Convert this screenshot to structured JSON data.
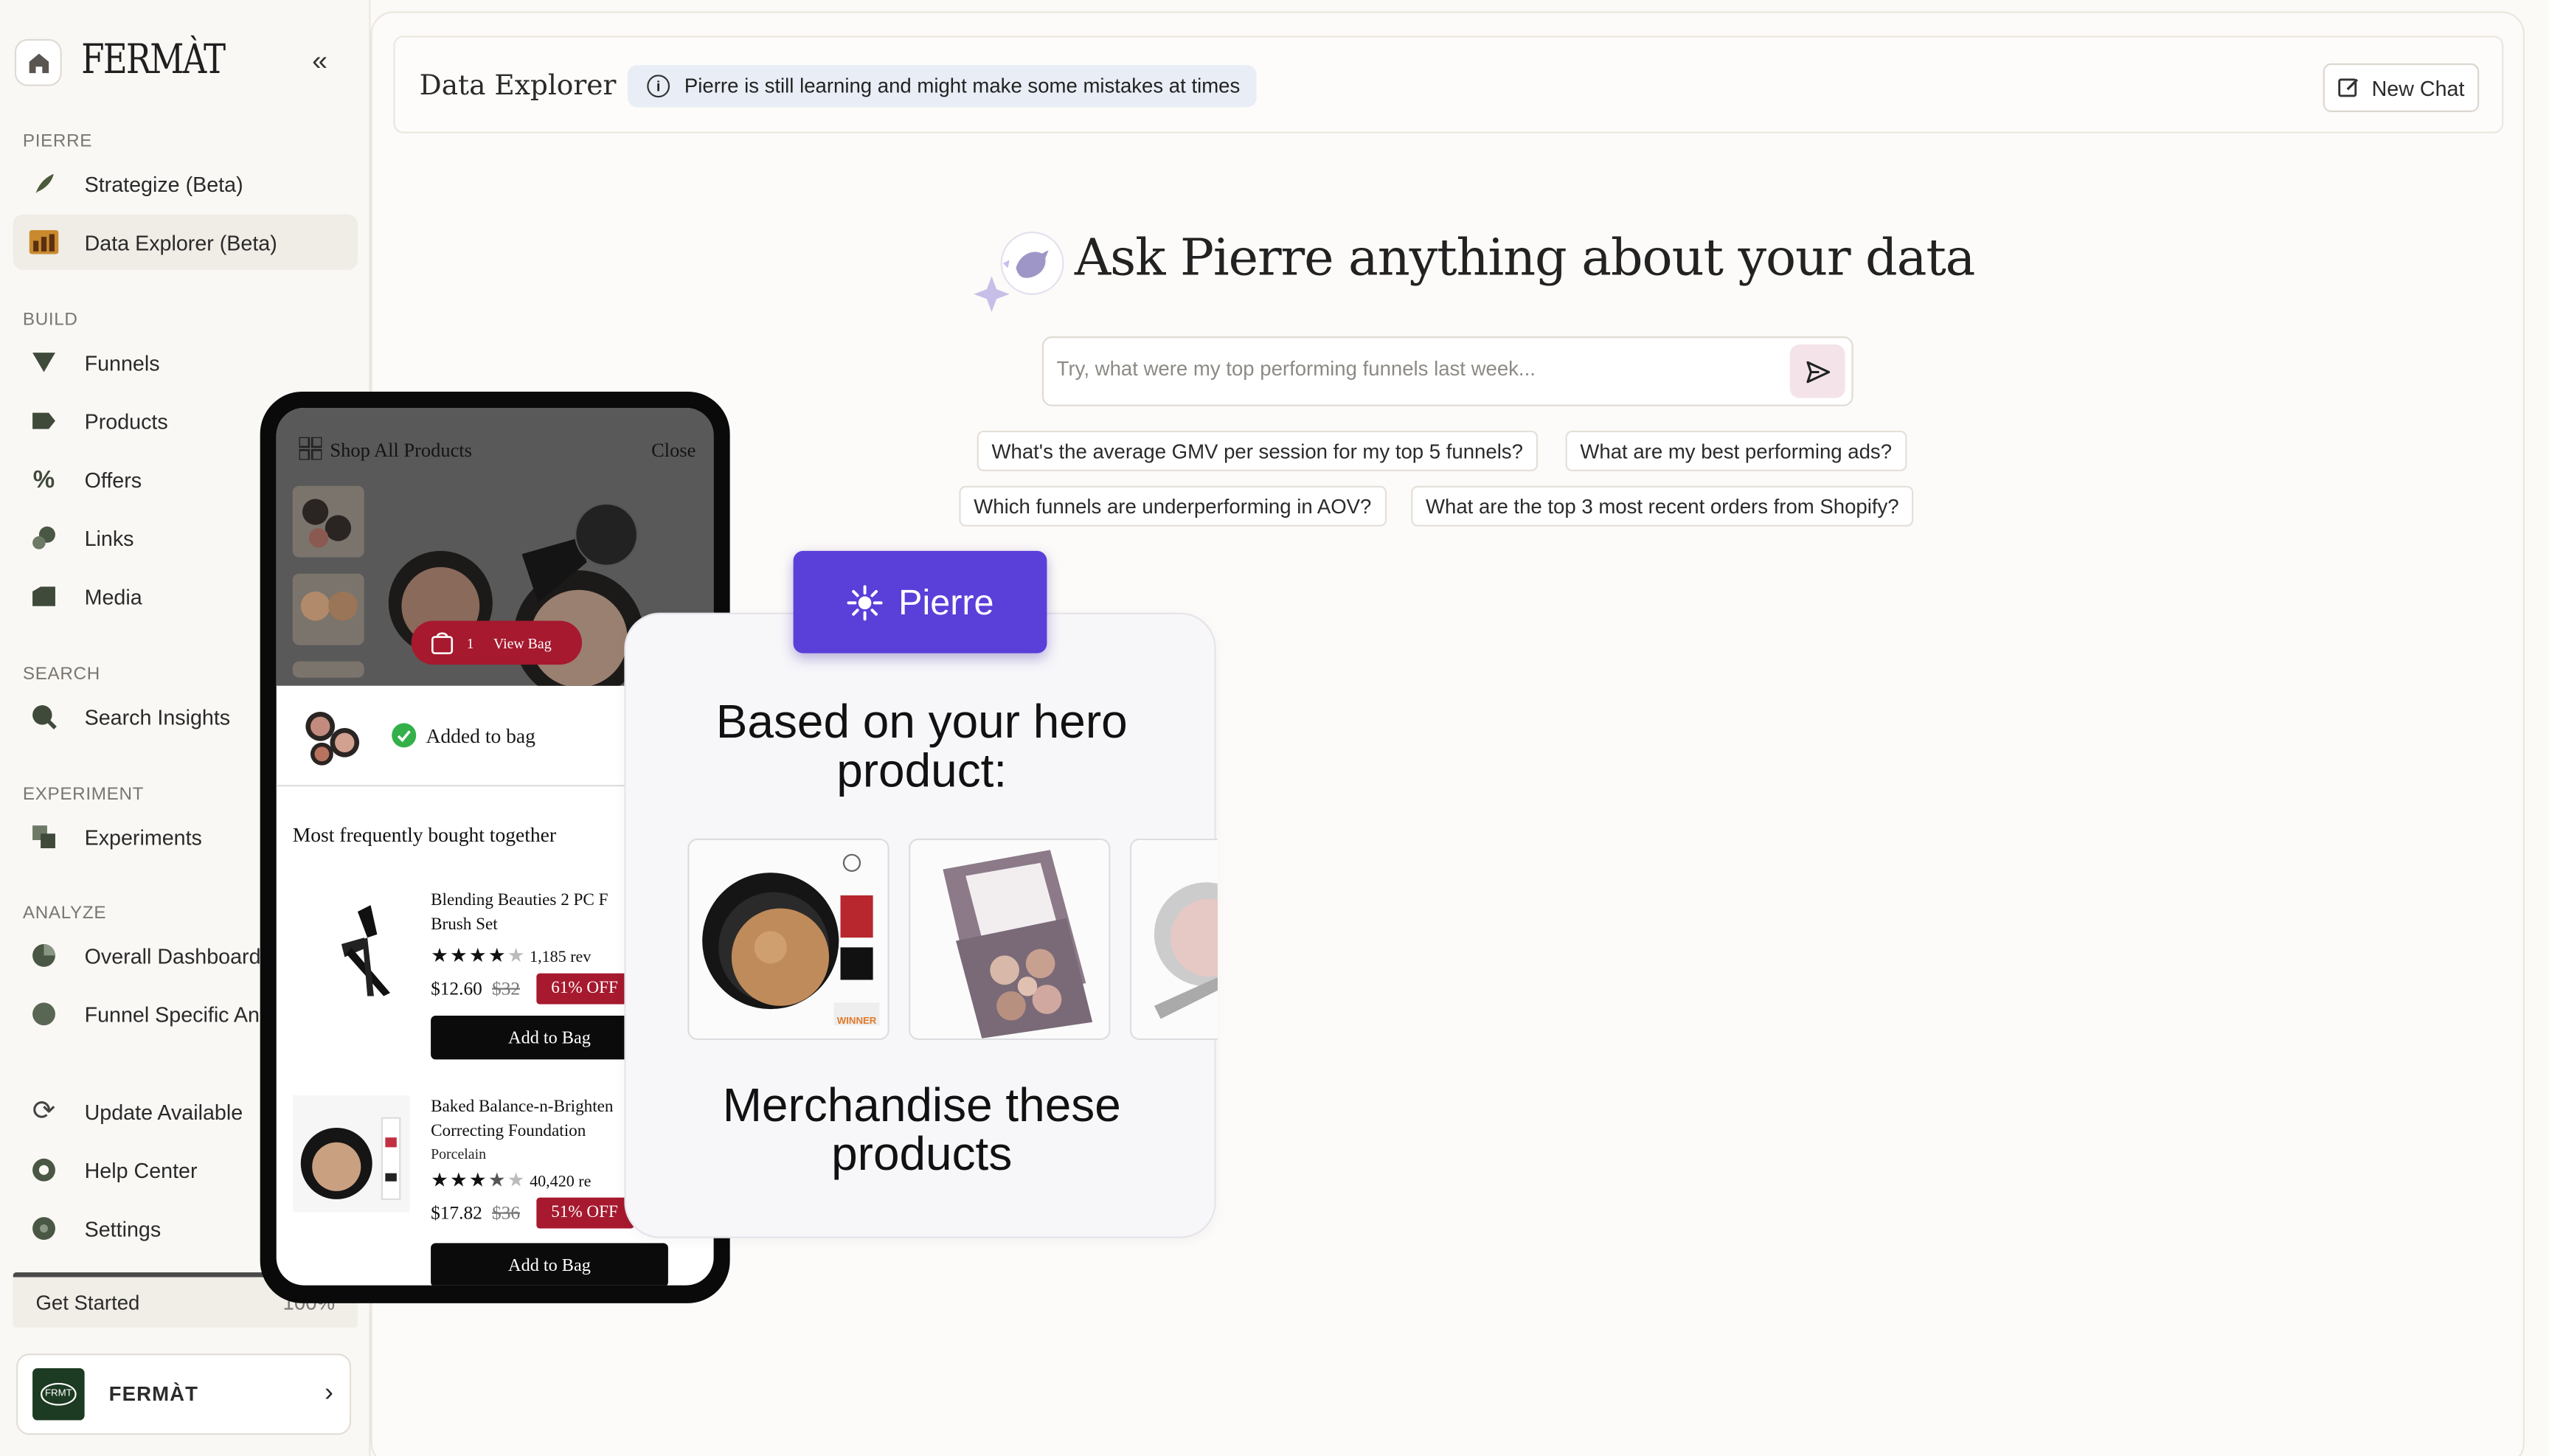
{
  "sidebar": {
    "logo": "FERMÀT",
    "sections": {
      "pierre": "PIERRE",
      "build": "BUILD",
      "search": "SEARCH",
      "experiment": "EXPERIMENT",
      "analyze": "ANALYZE"
    },
    "items": {
      "strategize": "Strategize (Beta)",
      "data_explorer": "Data Explorer (Beta)",
      "funnels": "Funnels",
      "products": "Products",
      "offers": "Offers",
      "links": "Links",
      "media": "Media",
      "search_insights": "Search Insights",
      "experiments": "Experiments",
      "overall_dashboard": "Overall Dashboard",
      "funnel_specific": "Funnel Specific Ana",
      "update": "Update Available",
      "help": "Help Center",
      "settings": "Settings"
    },
    "get_started": {
      "label": "Get Started",
      "progress": "100%"
    },
    "account": {
      "logo_text": "FRMT",
      "name": "FERMÀT"
    }
  },
  "header": {
    "title": "Data Explorer",
    "notice": "Pierre is still learning and might make some mistakes at times",
    "new_chat": "New Chat"
  },
  "hero": {
    "title": "Ask Pierre anything about your data",
    "search_placeholder": "Try, what were my top performing funnels last week..."
  },
  "suggestions": [
    "What's the average GMV per session for my top 5 funnels?",
    "What are my best performing ads?",
    "Which funnels are underperforming in AOV?",
    "What are the top 3 most recent orders from Shopify?"
  ],
  "phone": {
    "shop_title": "Shop All Products",
    "close": "Close",
    "bag_count": "1",
    "view_bag": "View Bag",
    "added": "Added to bag",
    "section_title": "Most frequently bought together",
    "products": [
      {
        "name_line1": "Blending Beauties 2 PC F",
        "name_line2": "Brush Set",
        "rating": 4.5,
        "reviews": "1,185 rev",
        "price": "$12.60",
        "old_price": "$32",
        "discount": "61% OFF",
        "cta": "Add to Bag"
      },
      {
        "name_line1": "Baked Balance-n-Brighten",
        "name_line2": "Correcting Foundation",
        "shade": "Porcelain",
        "rating": 3.5,
        "reviews": "40,420 re",
        "price": "$17.82",
        "old_price": "$36",
        "discount": "51% OFF",
        "cta": "Add to Bag"
      }
    ]
  },
  "pierre_card": {
    "button": "Pierre",
    "headline": "Based on your hero product:",
    "subhead": "Merchandise these products",
    "award_text": "WINNER"
  },
  "colors": {
    "accent": "#5b3fd9",
    "sale_red": "#a6192e",
    "notice_bg": "#e9eef6"
  }
}
